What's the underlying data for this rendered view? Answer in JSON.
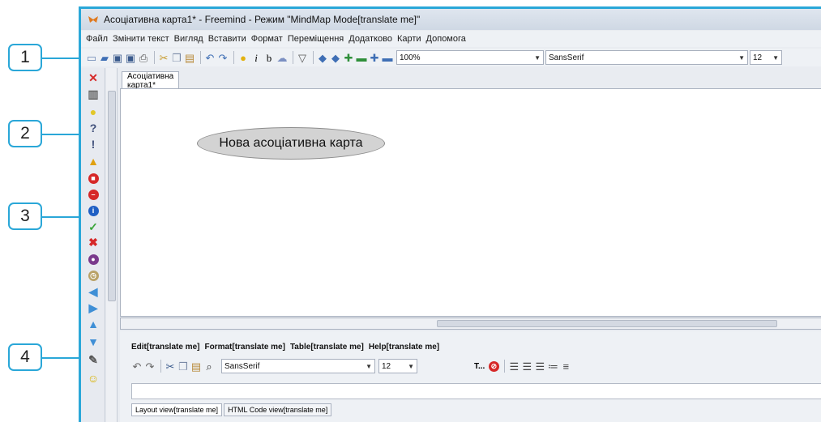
{
  "window": {
    "title": "Асоціативна карта1* - Freemind - Режим \"MindMap Mode[translate me]\""
  },
  "menu": [
    "Файл",
    "Змінити текст",
    "Вигляд",
    "Вставити",
    "Формат",
    "Переміщення",
    "Додатково",
    "Карти",
    "Допомога"
  ],
  "toolbar": {
    "zoom_value": "100%",
    "font_family": "SansSerif",
    "font_size": "12",
    "icons": [
      "new-icon",
      "open-icon",
      "save-icon",
      "save-as-icon",
      "print-icon",
      "cut-icon",
      "copy-icon",
      "paste-icon",
      "undo-icon",
      "redo-icon",
      "bulb-icon",
      "italic-icon",
      "bold-icon",
      "cloud-icon",
      "filter-icon",
      "back-icon",
      "forward-icon",
      "zoom-in-icon",
      "zoom-out-icon",
      "fold-icon",
      "unfold-icon"
    ]
  },
  "tab": {
    "label": "Асоціативна карта1*"
  },
  "map": {
    "root_node": "Нова асоціативна карта"
  },
  "callouts": [
    "1",
    "2",
    "3",
    "4"
  ],
  "icon_column": [
    "close-icon",
    "trash-icon",
    "bulb-icon",
    "question-icon",
    "exclamation-icon",
    "warning-icon",
    "stop-icon",
    "no-entry-icon",
    "info-icon",
    "check-icon",
    "cross-icon",
    "purple-circle-icon",
    "clock-icon",
    "arrow-left-icon",
    "arrow-right-icon",
    "arrow-up-icon",
    "arrow-down-icon",
    "wrench-icon",
    "smiley-icon"
  ],
  "editor": {
    "menu": [
      "Edit[translate me]",
      "Format[translate me]",
      "Table[translate me]",
      "Help[translate me]"
    ],
    "font_family": "SansSerif",
    "font_size": "12",
    "text_label": "T...",
    "tabs": [
      "Layout view[translate me]",
      "HTML Code view[translate me]"
    ]
  },
  "colors": {
    "accent": "#2aa7d8",
    "node_fill": "#d3d3d3"
  }
}
